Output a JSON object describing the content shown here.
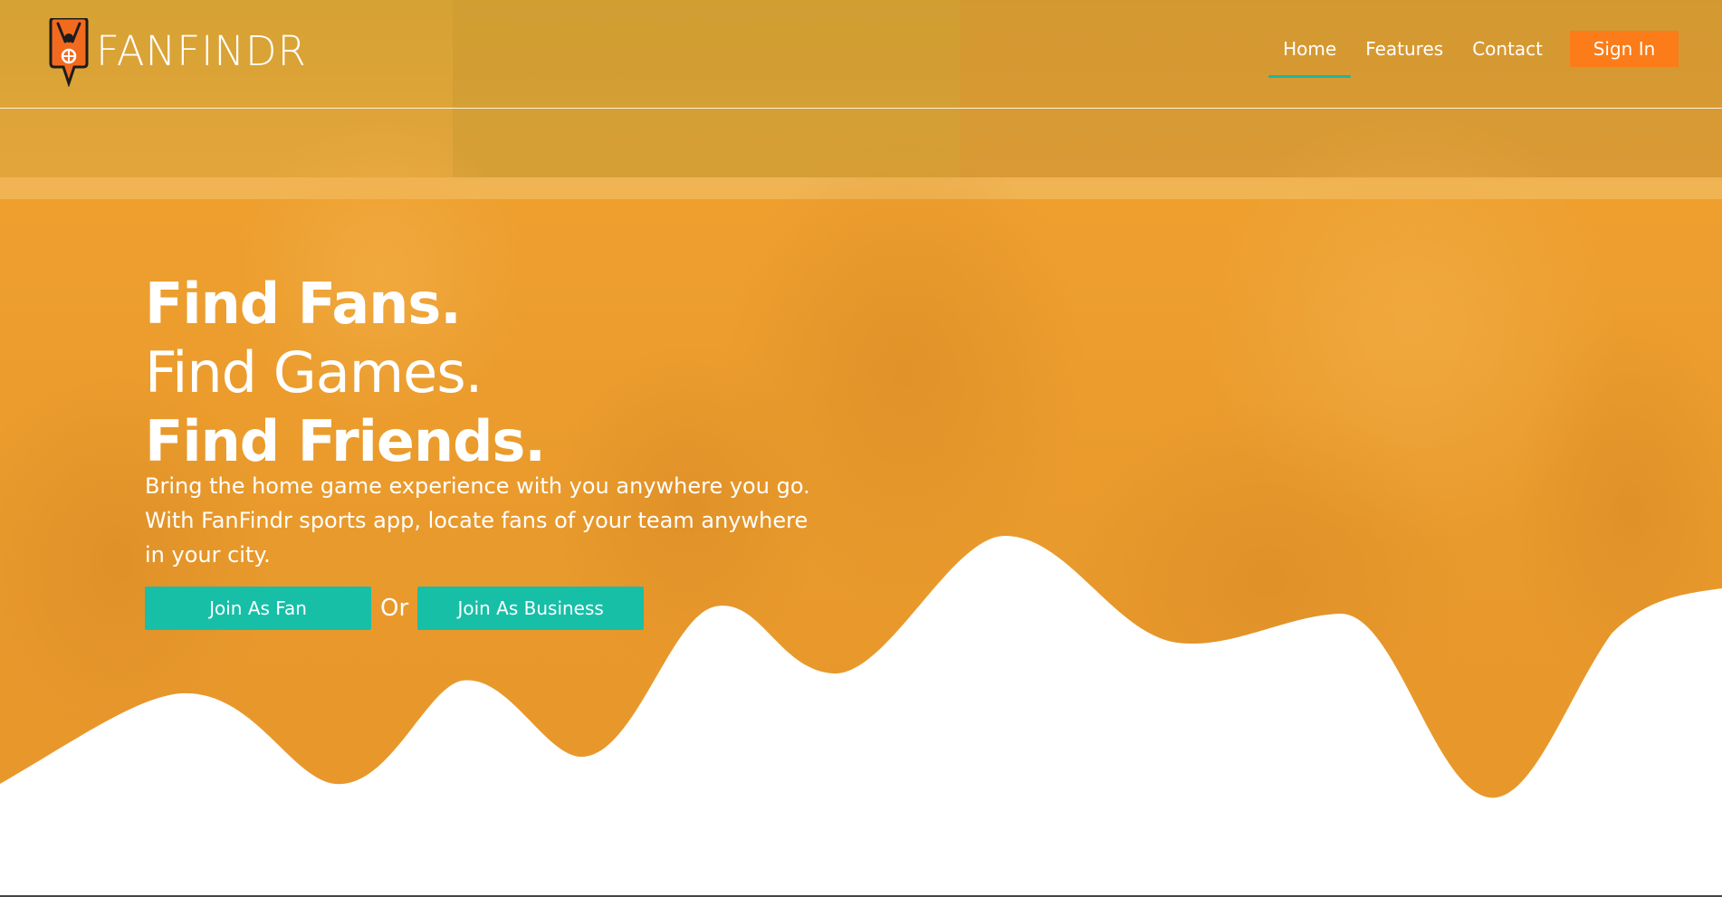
{
  "brand": {
    "name": "FANFINDR",
    "colors": {
      "accent_orange": "#fb7c18",
      "accent_teal": "#17bfa7",
      "hero_overlay": "#ee9f2e"
    }
  },
  "nav": {
    "items": [
      {
        "label": "Home",
        "active": true
      },
      {
        "label": "Features",
        "active": false
      },
      {
        "label": "Contact",
        "active": false
      }
    ],
    "sign_in": "Sign In"
  },
  "hero": {
    "line1": "Find Fans.",
    "line2": "Find Games.",
    "line3": "Find Friends.",
    "subtitle": "Bring the home game experience with you anywhere you go. With FanFindr sports app, locate fans of your team anywhere in your city.",
    "cta_fan": "Join As Fan",
    "cta_or": "Or",
    "cta_business": "Join As Business"
  },
  "icons": {
    "logo": "cheering-fan-pin-icon"
  }
}
